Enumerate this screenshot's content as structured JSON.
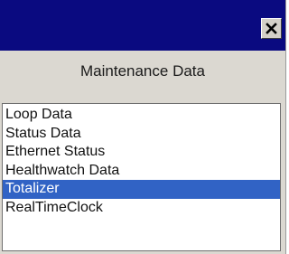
{
  "window": {
    "title": "",
    "header_label": "Maintenance Data",
    "close_icon": "close-icon"
  },
  "list": {
    "items": [
      {
        "label": "Loop Data",
        "selected": false
      },
      {
        "label": "Status Data",
        "selected": false
      },
      {
        "label": "Ethernet Status",
        "selected": false
      },
      {
        "label": "Healthwatch Data",
        "selected": false
      },
      {
        "label": "Totalizer",
        "selected": true
      },
      {
        "label": "RealTimeClock",
        "selected": false
      }
    ],
    "selected_index": 4
  },
  "colors": {
    "titlebar": "#0a0a80",
    "panel": "#dbd8d1",
    "selection": "#3163c5"
  }
}
